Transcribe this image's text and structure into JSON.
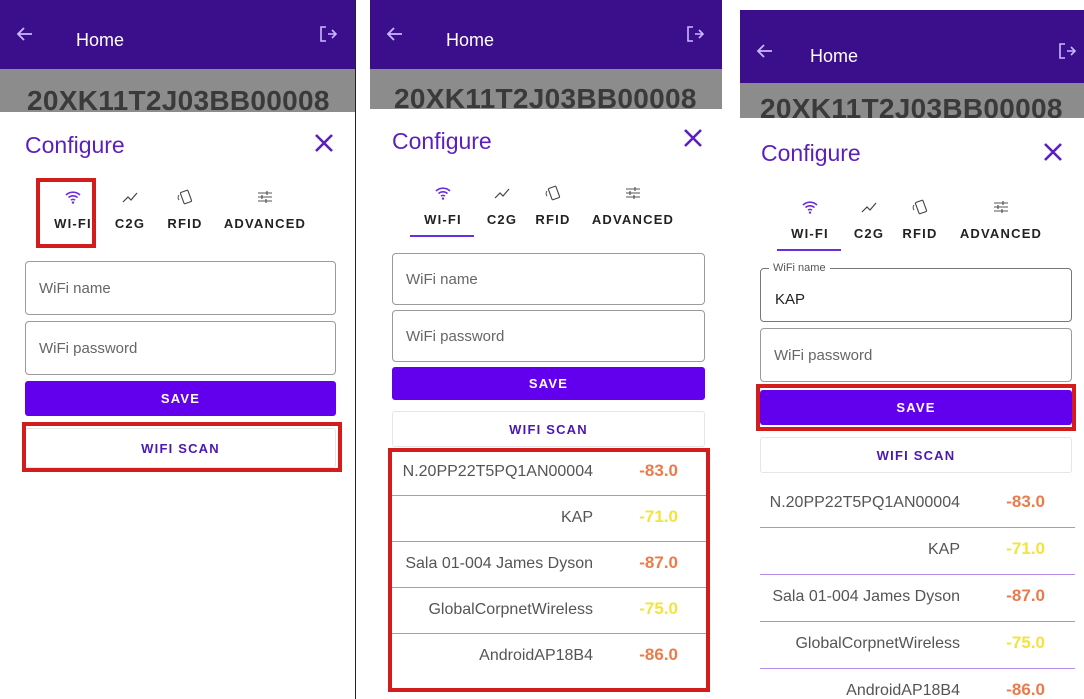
{
  "app": {
    "title": "Home",
    "serial": "20XK11T2J03BB00008",
    "configure_title": "Configure"
  },
  "tabs": [
    {
      "label": "WI-FI",
      "icon": "wifi-icon"
    },
    {
      "label": "C2G",
      "icon": "trend-icon"
    },
    {
      "label": "RFID",
      "icon": "rfid-icon"
    },
    {
      "label": "ADVANCED",
      "icon": "sliders-icon"
    }
  ],
  "form": {
    "wifi_name_label": "WiFi name",
    "wifi_name_placeholder": "WiFi name",
    "wifi_password_placeholder": "WiFi password",
    "wifi_name_value_filled": "KAP",
    "save_label": "SAVE",
    "scan_label": "WIFI SCAN"
  },
  "networks": [
    {
      "name": "N.20PP22T5PQ1AN00004",
      "signal": "-83.0"
    },
    {
      "name": "KAP",
      "signal": "-71.0"
    },
    {
      "name": "Sala 01-004 James Dyson",
      "signal": "-87.0"
    },
    {
      "name": "GlobalCorpnetWireless",
      "signal": "-75.0"
    },
    {
      "name": "AndroidAP18B4",
      "signal": "-86.0"
    }
  ],
  "colors": {
    "appbar": "#3b0f8c",
    "accent": "#6200ee",
    "highlight": "#d31d1d",
    "signal_weak": "#ea7b4a",
    "signal_fair": "#f4e33e"
  }
}
